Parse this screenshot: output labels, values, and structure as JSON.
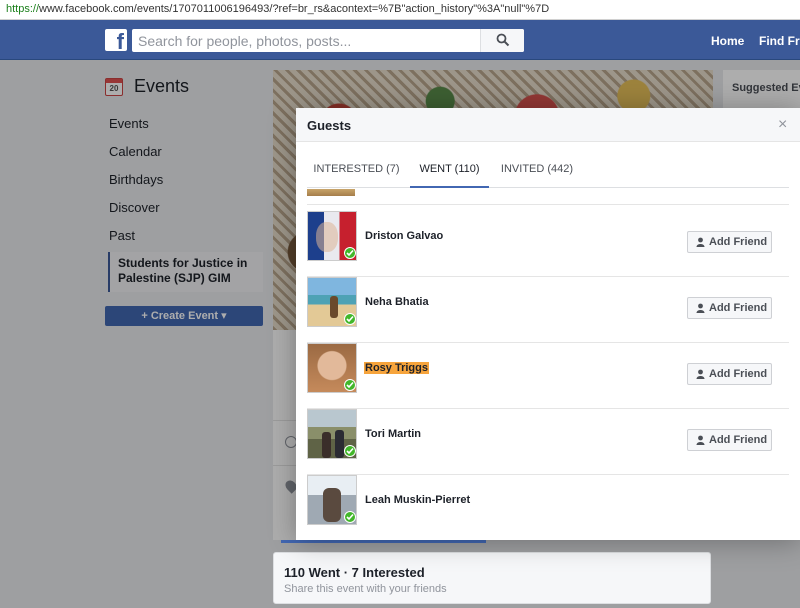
{
  "browser": {
    "url_scheme": "https://",
    "url_rest": "www.facebook.com/events/1707011006196493/?ref=br_rs&acontext=%7B\"action_history\"%3A\"null\"%7D"
  },
  "topbar": {
    "logo": "f",
    "search_placeholder": "Search for people, photos, posts...",
    "home_label": "Home",
    "find_friends_label": "Find Frie"
  },
  "sidebar": {
    "calendar_day": "20",
    "title": "Events",
    "items": [
      {
        "label": "Events"
      },
      {
        "label": "Calendar"
      },
      {
        "label": "Birthdays"
      },
      {
        "label": "Discover"
      },
      {
        "label": "Past"
      }
    ],
    "group_label": "Students for Justice in Palestine (SJP) GIM",
    "create_button": "Create Event"
  },
  "event": {
    "summary": "110 Went · 7 Interested",
    "share_prompt": "Share this event with your friends",
    "suggested_heading": "Suggested Ev"
  },
  "dialog": {
    "title": "Guests",
    "close": "×",
    "tabs": [
      {
        "label": "INTERESTED (7)"
      },
      {
        "label": "WENT (110)"
      },
      {
        "label": "INVITED (442)"
      }
    ],
    "active_tab": "WENT (110)",
    "add_friend_label": "Add Friend",
    "guests": [
      {
        "name": "Driston Galvao",
        "highlighted": false
      },
      {
        "name": "Neha Bhatia",
        "highlighted": false
      },
      {
        "name": "Rosy Triggs",
        "highlighted": true
      },
      {
        "name": "Tori Martin",
        "highlighted": false
      },
      {
        "name": "Leah Muskin-Pierret",
        "highlighted": false
      }
    ]
  },
  "colors": {
    "facebook_blue": "#3b5998",
    "button_blue": "#4267b2",
    "went_check": "#42b72a",
    "highlight": "#f6a43c"
  }
}
